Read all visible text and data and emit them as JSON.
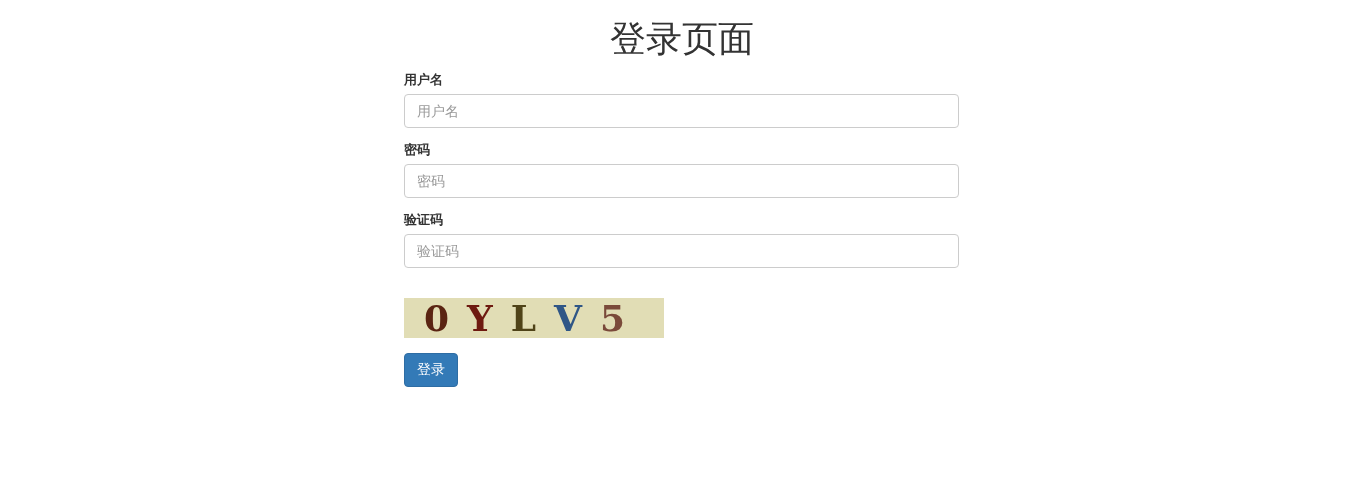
{
  "title": "登录页面",
  "fields": [
    {
      "label": "用户名",
      "placeholder": "用户名"
    },
    {
      "label": "密码",
      "placeholder": "密码"
    },
    {
      "label": "验证码",
      "placeholder": "验证码"
    }
  ],
  "captcha": {
    "characters": [
      {
        "char": "0",
        "color": "#5a2412"
      },
      {
        "char": "Y",
        "color": "#6e1a10"
      },
      {
        "char": "L",
        "color": "#4f4318"
      },
      {
        "char": "V",
        "color": "#2f5686"
      },
      {
        "char": "5",
        "color": "#7a4a3a"
      }
    ]
  },
  "submit_button": "登录"
}
